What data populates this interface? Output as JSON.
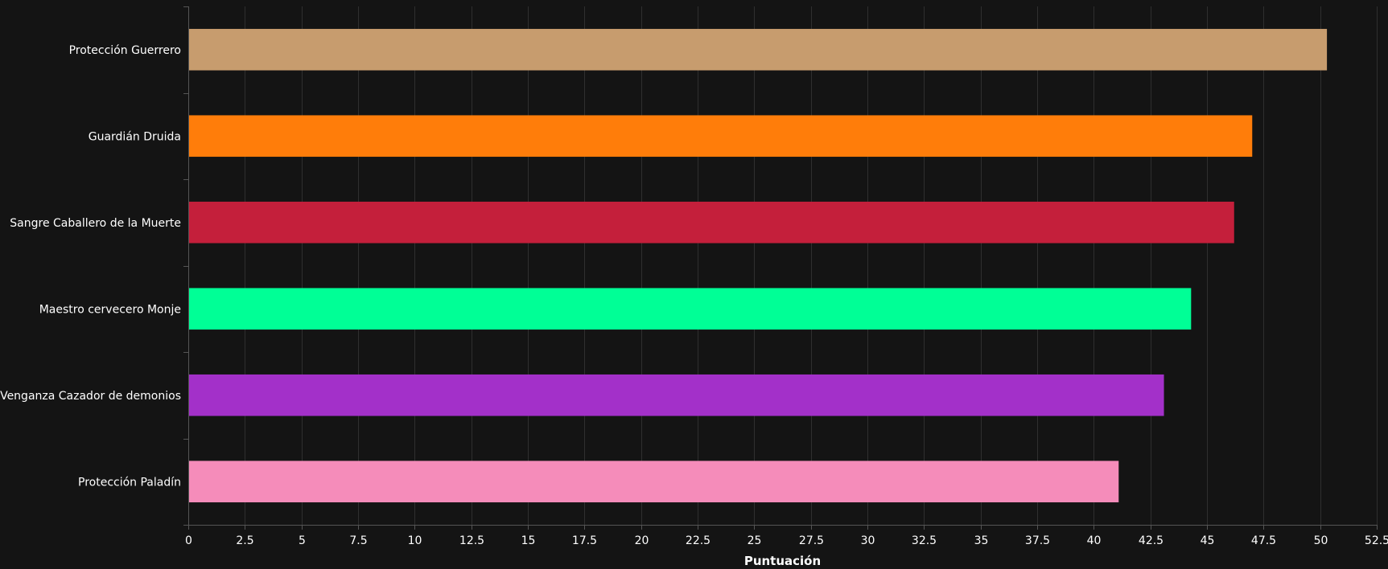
{
  "chart_data": {
    "type": "bar",
    "orientation": "horizontal",
    "categories": [
      "Protección Guerrero",
      "Guardián Druida",
      "Sangre Caballero de la Muerte",
      "Maestro cervecero Monje",
      "Venganza Cazador de demonios",
      "Protección Paladín"
    ],
    "values": [
      50.3,
      47.0,
      46.2,
      44.3,
      43.1,
      41.1
    ],
    "colors": [
      "#c79c6e",
      "#ff7d0a",
      "#c41f3b",
      "#00ff96",
      "#a330c9",
      "#f58cba"
    ],
    "xlabel": "Puntuación",
    "ylabel": "",
    "xlim": [
      0,
      52.5
    ],
    "xticks": [
      0,
      2.5,
      5,
      7.5,
      10,
      12.5,
      15,
      17.5,
      20,
      22.5,
      25,
      27.5,
      30,
      32.5,
      35,
      37.5,
      40,
      42.5,
      45,
      47.5,
      50,
      52.5
    ],
    "xtick_labels": [
      "0",
      "2.5",
      "5",
      "7.5",
      "10",
      "12.5",
      "15",
      "17.5",
      "20",
      "22.5",
      "25",
      "27.5",
      "30",
      "32.5",
      "35",
      "37.5",
      "40",
      "42.5",
      "45",
      "47.5",
      "50",
      "52.5"
    ],
    "grid": "vertical",
    "background": "#141414"
  }
}
